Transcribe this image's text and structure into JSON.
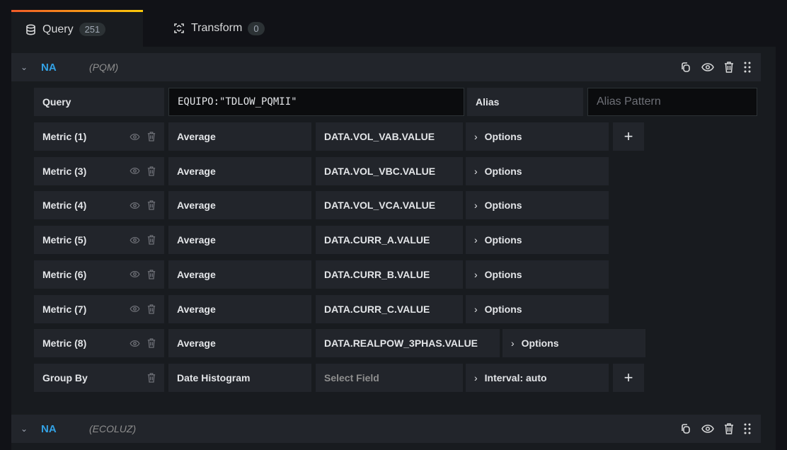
{
  "tabs": [
    {
      "label": "Query",
      "count": "251",
      "icon": "database-icon"
    },
    {
      "label": "Transform",
      "count": "0",
      "icon": "transform-icon"
    }
  ],
  "query1": {
    "name": "NA",
    "datasource": "(PQM)",
    "query_label": "Query",
    "query_value": "EQUIPO:\"TDLOW_PQMII\"",
    "alias_label": "Alias",
    "alias_placeholder": "Alias Pattern",
    "metrics": [
      {
        "label": "Metric (1)",
        "agg": "Average",
        "field": "DATA.VOL_VAB.VALUE",
        "options": "Options"
      },
      {
        "label": "Metric (3)",
        "agg": "Average",
        "field": "DATA.VOL_VBC.VALUE",
        "options": "Options"
      },
      {
        "label": "Metric (4)",
        "agg": "Average",
        "field": "DATA.VOL_VCA.VALUE",
        "options": "Options"
      },
      {
        "label": "Metric (5)",
        "agg": "Average",
        "field": "DATA.CURR_A.VALUE",
        "options": "Options"
      },
      {
        "label": "Metric (6)",
        "agg": "Average",
        "field": "DATA.CURR_B.VALUE",
        "options": "Options"
      },
      {
        "label": "Metric (7)",
        "agg": "Average",
        "field": "DATA.CURR_C.VALUE",
        "options": "Options"
      },
      {
        "label": "Metric (8)",
        "agg": "Average",
        "field": "DATA.REALPOW_3PHAS.VALUE",
        "options": "Options"
      }
    ],
    "group_by": {
      "label": "Group By",
      "type": "Date Histogram",
      "field_placeholder": "Select Field",
      "interval": "Interval: auto"
    }
  },
  "query2": {
    "name": "NA",
    "datasource": "(ECOLUZ)"
  },
  "colors": {
    "accent": "#33a2e5",
    "tab_gradient_start": "#f05a28",
    "tab_gradient_end": "#fbca0a"
  }
}
